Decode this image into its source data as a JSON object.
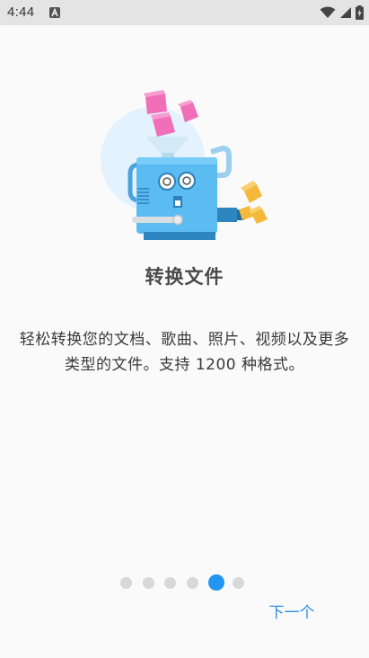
{
  "status_bar": {
    "time": "4:44"
  },
  "onboarding": {
    "title": "转换文件",
    "description": "轻松转换您的文档、歌曲、照片、视频以及更多类型的文件。支持 1200 种格式。",
    "page_indicator": {
      "total": 6,
      "current": 5
    },
    "next_label": "下一个"
  },
  "colors": {
    "accent": "#2196f3",
    "machine_body": "#5bbcf2",
    "machine_dark": "#2e86c1",
    "pink_cube": "#f06fb8",
    "yellow_cube": "#f4b93a",
    "halo": "#e3f2fc",
    "dot_inactive": "#d8d8d8"
  },
  "icons": [
    "wifi-icon",
    "signal-icon",
    "battery-icon",
    "notification-a-icon"
  ]
}
